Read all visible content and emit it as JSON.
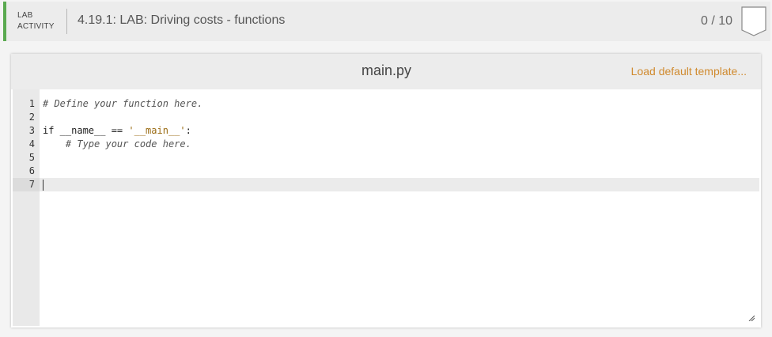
{
  "header": {
    "tag_line1": "LAB",
    "tag_line2": "ACTIVITY",
    "title": "4.19.1: LAB: Driving costs - functions",
    "score": "0 / 10",
    "accent_color": "#5aaa50"
  },
  "panel": {
    "file_name": "main.py",
    "load_template_label": "Load default template...",
    "link_color": "#d08a2e"
  },
  "editor": {
    "line_numbers": [
      "1",
      "2",
      "3",
      "4",
      "5",
      "6",
      "7"
    ],
    "lines": [
      "# Define your function here.",
      "",
      "if __name__ == '__main__':",
      "    # Type your code here.",
      "",
      "",
      ""
    ],
    "active_line": 7
  },
  "icons": {
    "score_badge": "score-badge-icon",
    "resize": "resize-grip-icon"
  }
}
